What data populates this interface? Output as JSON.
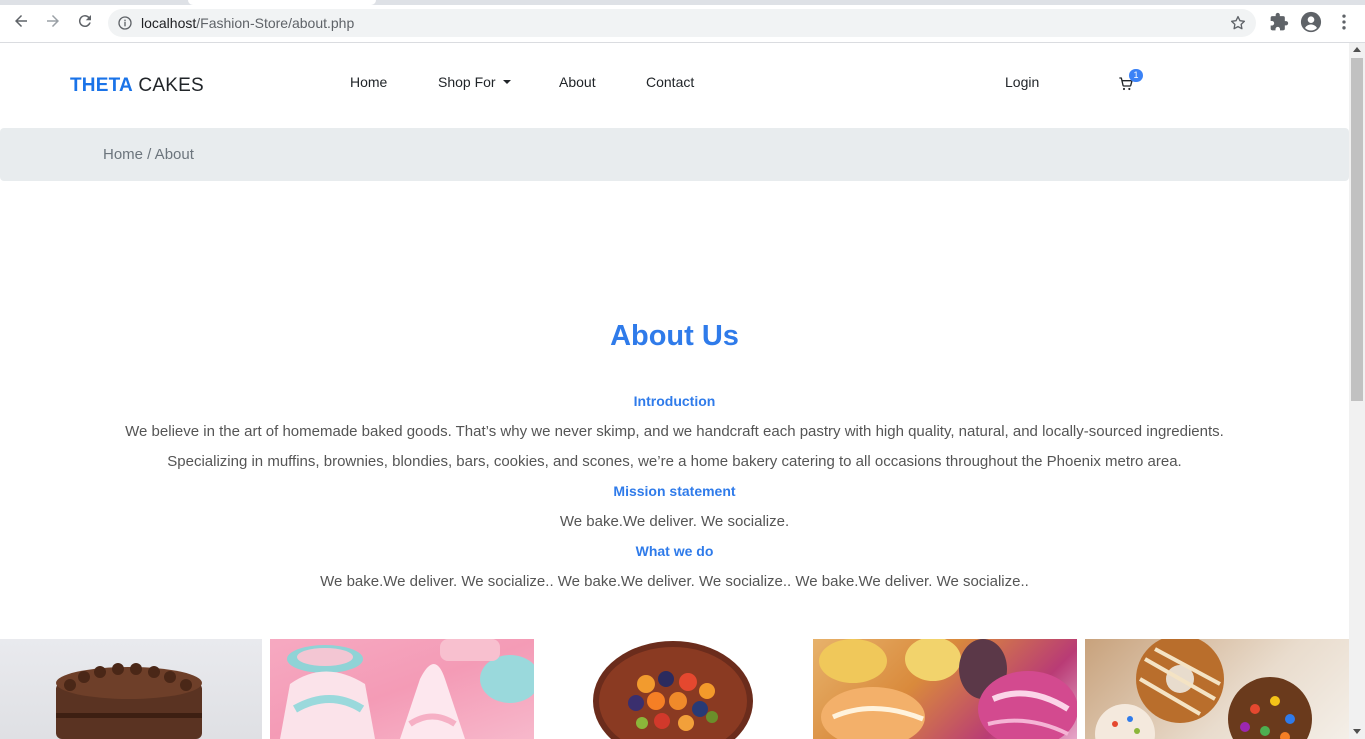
{
  "browser": {
    "url_host": "localhost",
    "url_path": "/Fashion-Store/about.php"
  },
  "nav": {
    "brand_accent": "THETA",
    "brand_rest": " CAKES",
    "home": "Home",
    "shop_for": "Shop For",
    "about": "About",
    "contact": "Contact",
    "login": "Login",
    "cart_count": "1"
  },
  "breadcrumb": {
    "text": "Home / About"
  },
  "about": {
    "title": "About Us",
    "intro_heading": "Introduction",
    "intro_line1": "We believe in the art of homemade baked goods. That’s why we never skimp, and we handcraft each pastry with high quality, natural, and locally-sourced ingredients.",
    "intro_line2": "Specializing in muffins, brownies, blondies, bars, cookies, and scones, we’re a home bakery catering to all occasions throughout the Phoenix metro area.",
    "mission_heading": "Mission statement",
    "mission_text": "We bake.We deliver. We socialize.",
    "whatwedo_heading": "What we do",
    "whatwedo_text": "We bake.We deliver. We socialize.. We bake.We deliver. We socialize.. We bake.We deliver. We socialize.."
  },
  "gallery": [
    "chocolate-cake",
    "meringue-cupcakes",
    "fruit-tart-cake",
    "macarons",
    "decorated-donuts"
  ],
  "colors": {
    "accent": "#2f7bea",
    "brand": "#1a73e8",
    "breadcrumb_bg": "#e8ecee",
    "badge": "#3b82f6"
  }
}
